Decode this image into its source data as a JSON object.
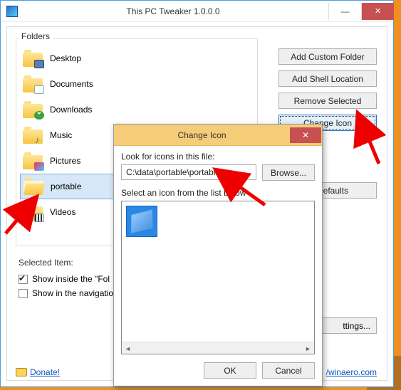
{
  "main": {
    "title": "This PC Tweaker 1.0.0.0",
    "foldersLabel": "Folders",
    "folders": [
      {
        "name": "Desktop",
        "sub": "display",
        "selected": false
      },
      {
        "name": "Documents",
        "sub": "doc",
        "selected": false
      },
      {
        "name": "Downloads",
        "sub": "down",
        "selected": false
      },
      {
        "name": "Music",
        "sub": "music",
        "selected": false
      },
      {
        "name": "Pictures",
        "sub": "pics",
        "selected": false
      },
      {
        "name": "portable",
        "sub": "",
        "selected": true
      },
      {
        "name": "Videos",
        "sub": "vids",
        "selected": false
      }
    ],
    "selectedItem": {
      "title": "Selected Item:",
      "opts": [
        {
          "label": "Show inside the \"Fol",
          "checked": true
        },
        {
          "label": "Show in the navigatio",
          "checked": false
        }
      ]
    },
    "donate": "Donate!",
    "rightButtons": {
      "addCustom": "Add Custom Folder",
      "addShell": "Add Shell Location",
      "removeSel": "Remove Selected",
      "changeIcon": "Change Icon",
      "restoreDef": "re Defaults",
      "settings": "ttings..."
    },
    "site": "/winaero.com"
  },
  "dialog": {
    "title": "Change Icon",
    "lookLabel": "Look for icons in this file:",
    "path": "C:\\data\\portable\\portable.ico",
    "browse": "Browse...",
    "selectLabel": "Select an icon from the list below",
    "ok": "OK",
    "cancel": "Cancel"
  }
}
